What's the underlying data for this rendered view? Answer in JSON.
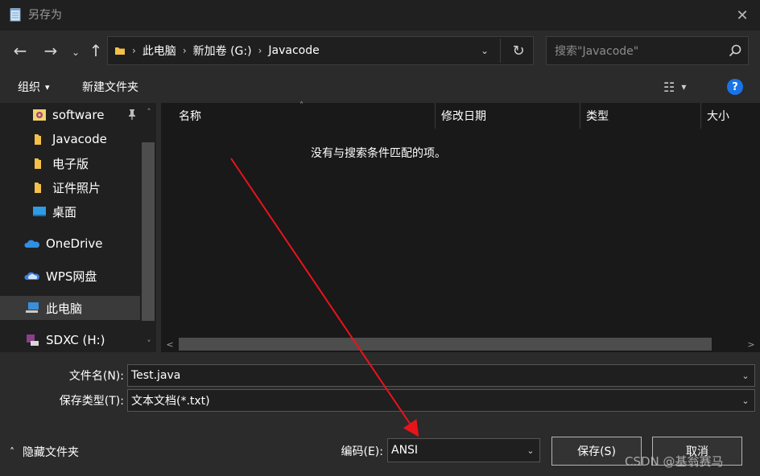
{
  "window": {
    "title": "另存为",
    "close_glyph": "✕"
  },
  "nav": {
    "back_glyph": "←",
    "forward_glyph": "→",
    "recent_glyph": "⌄",
    "up_glyph": "↑",
    "address": {
      "crumbs": [
        "此电脑",
        "新加卷 (G:)",
        "Javacode"
      ],
      "separator": "›",
      "dropdown_glyph": "⌄",
      "refresh_glyph": "↻"
    },
    "search": {
      "placeholder": "搜索\"Javacode\"",
      "icon": "search-icon"
    }
  },
  "toolbar": {
    "organize_label": "组织",
    "organize_arrow": "▾",
    "new_folder_label": "新建文件夹",
    "view_glyph": "☷",
    "view_arrow": "▾",
    "help_glyph": "?"
  },
  "sidebar": {
    "items": [
      {
        "label": "software",
        "icon": "software-icon",
        "pinned": true
      },
      {
        "label": "Javacode",
        "icon": "folder-icon"
      },
      {
        "label": "电子版",
        "icon": "folder-icon"
      },
      {
        "label": "证件照片",
        "icon": "folder-icon"
      },
      {
        "label": "桌面",
        "icon": "desktop-icon"
      },
      {
        "label": "OneDrive",
        "icon": "onedrive-icon"
      },
      {
        "label": "WPS网盘",
        "icon": "wps-cloud-icon"
      },
      {
        "label": "此电脑",
        "icon": "this-pc-icon",
        "selected": true
      },
      {
        "label": "SDXC (H:)",
        "icon": "sd-card-icon"
      }
    ],
    "pin_glyph": "📌",
    "scroll_up_glyph": "˄",
    "scroll_down_glyph": "˅"
  },
  "file_list": {
    "columns": [
      "名称",
      "修改日期",
      "类型",
      "大小"
    ],
    "sort_glyph": "˄",
    "empty_message": "没有与搜索条件匹配的项。",
    "hscroll_left_glyph": "<",
    "hscroll_right_glyph": ">"
  },
  "form": {
    "filename_label": "文件名(N):",
    "filename_value": "Test.java",
    "filetype_label": "保存类型(T):",
    "filetype_value": "文本文档(*.txt)",
    "encoding_label": "编码(E):",
    "encoding_value": "ANSI",
    "combo_arrow": "⌄",
    "hide_folders_glyph": "˄",
    "hide_folders_label": "隐藏文件夹",
    "save_label": "保存(S)",
    "cancel_label": "取消"
  },
  "watermark": "CSDN @基翁赛马",
  "colors": {
    "annotation_arrow": "#e8141b",
    "accent_blue": "#1a73e8",
    "folder_yellow": "#f5c04a"
  }
}
